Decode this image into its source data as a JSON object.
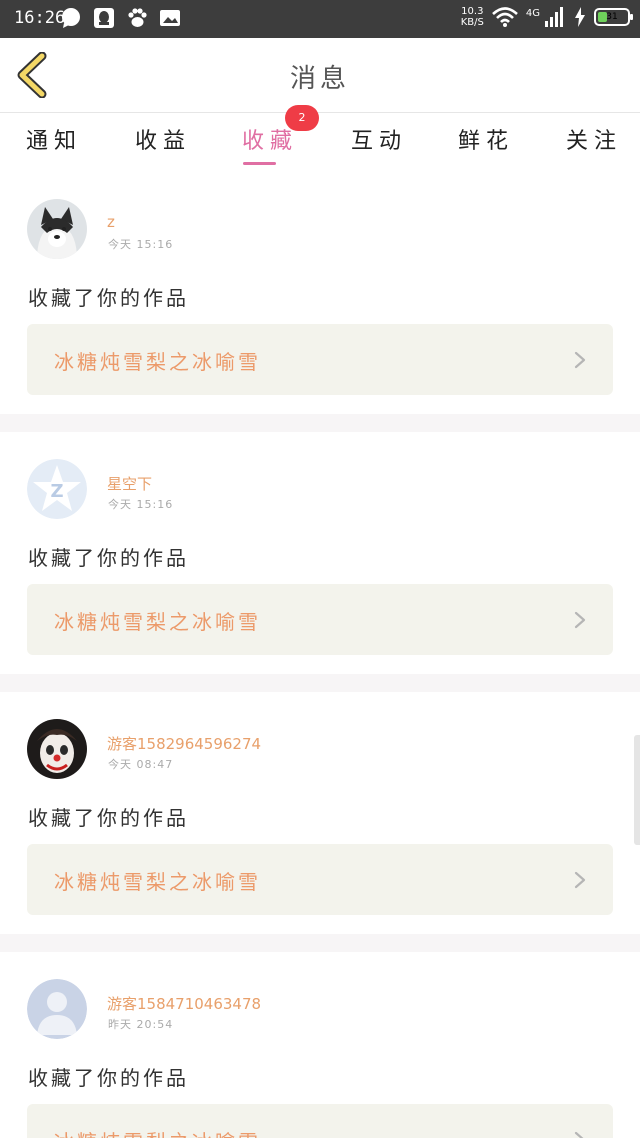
{
  "status_bar": {
    "time": "16:26",
    "speed_value": "10.3",
    "speed_unit": "KB/S",
    "network": "4G",
    "battery_level": "31"
  },
  "header": {
    "title": "消息"
  },
  "tabs": [
    {
      "label": "通知"
    },
    {
      "label": "收益"
    },
    {
      "label": "收藏",
      "active": true,
      "badge": "2"
    },
    {
      "label": "互动"
    },
    {
      "label": "鲜花"
    },
    {
      "label": "关注"
    }
  ],
  "messages": [
    {
      "user": "z",
      "time": "今天 15:16",
      "action": "收藏了你的作品",
      "work_title": "冰糖炖雪梨之冰喻雪",
      "avatar": "husky-avatar"
    },
    {
      "user": "星空下",
      "time": "今天 15:16",
      "action": "收藏了你的作品",
      "work_title": "冰糖炖雪梨之冰喻雪",
      "avatar": "default-star-avatar"
    },
    {
      "user": "游客1582964596274",
      "time": "今天 08:47",
      "action": "收藏了你的作品",
      "work_title": "冰糖炖雪梨之冰喻雪",
      "avatar": "clown-avatar"
    },
    {
      "user": "游客1584710463478",
      "time": "昨天 20:54",
      "action": "收藏了你的作品",
      "work_title": "冰糖炖雪梨之冰喻雪",
      "avatar": "default-person-avatar"
    }
  ],
  "colors": {
    "accent": "#e06fa3",
    "badge": "#ef3c46",
    "username": "#e8a06b",
    "work_title": "#ec9a6a",
    "work_bg": "#f3f3ec"
  }
}
